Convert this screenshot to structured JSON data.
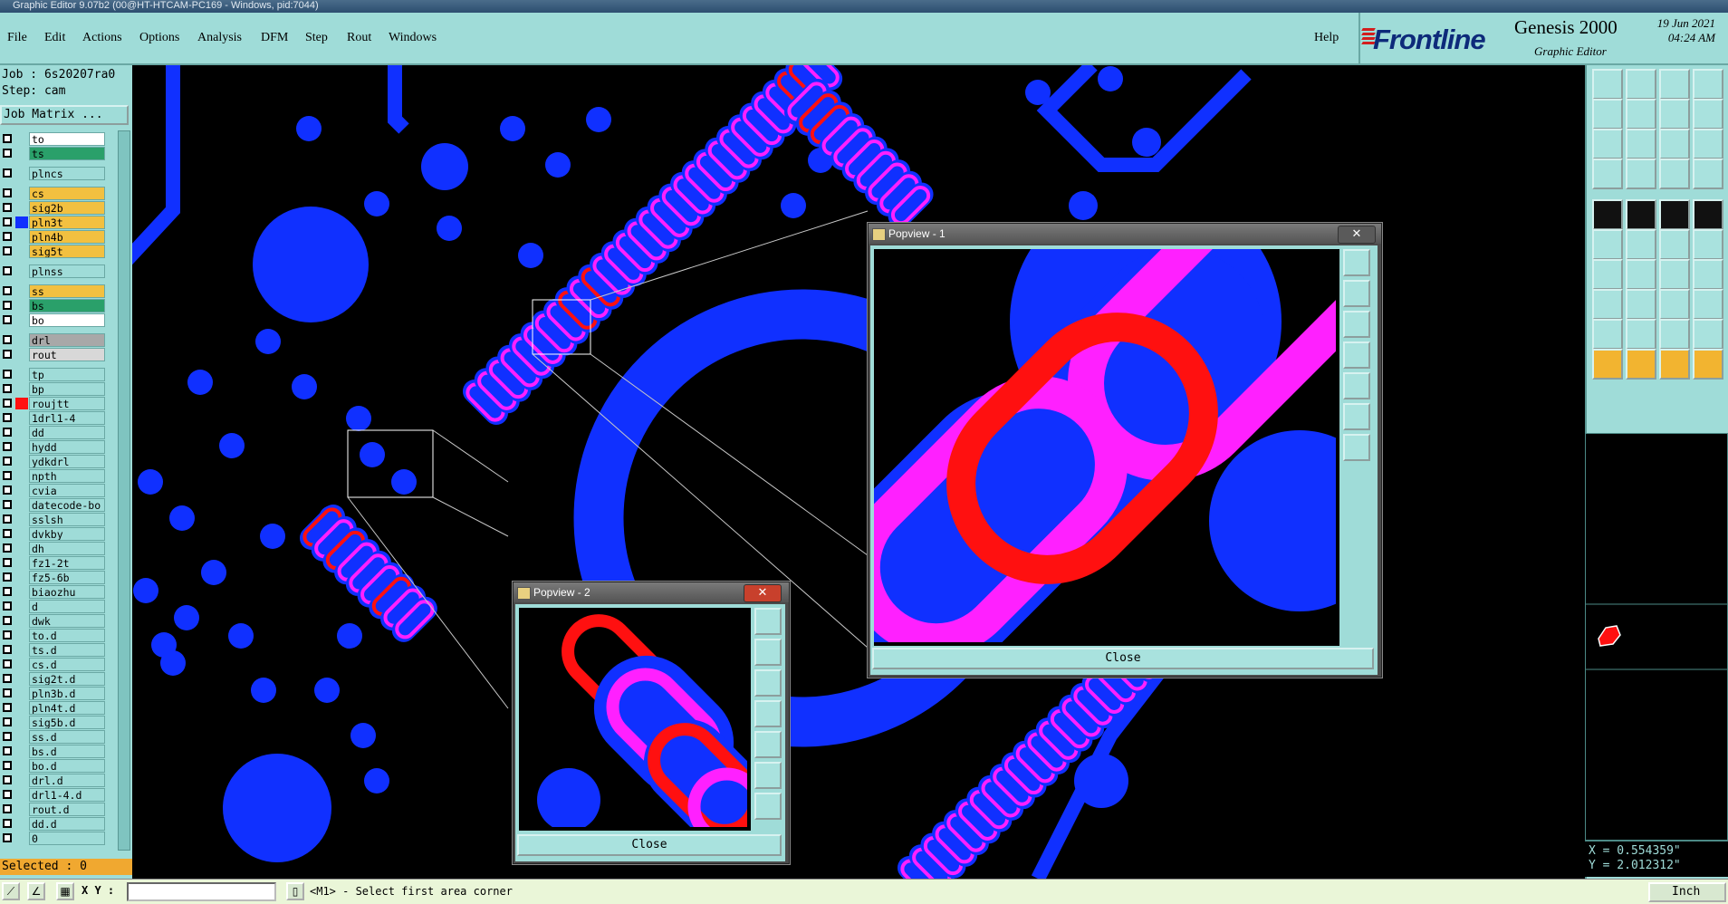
{
  "window": {
    "title": "Graphic Editor 9.07b2 (00@HT-HTCAM-PC169 - Windows, pid:7044)"
  },
  "menu": {
    "items": [
      "File",
      "Edit",
      "Actions",
      "Options",
      "Analysis",
      "DFM",
      "Step",
      "Rout",
      "Windows"
    ],
    "help": "Help"
  },
  "brand": {
    "logo": "Frontline",
    "product": "Genesis 2000",
    "subtitle": "Graphic Editor",
    "date": "19 Jun 2021",
    "time": "04:24 AM"
  },
  "job": {
    "job_line": "Job : 6s20207ra0",
    "step_line": "Step: cam",
    "matrix_button": "Job Matrix ..."
  },
  "layers": [
    {
      "name": "to",
      "color": "#ffffff"
    },
    {
      "name": "ts",
      "color": "#2aa06a"
    },
    {
      "name": "plncs",
      "color": "#9fdcd8"
    },
    {
      "name": "cs",
      "color": "#f2c040"
    },
    {
      "name": "sig2b",
      "color": "#f2c040"
    },
    {
      "name": "pln3t",
      "color": "#f2c040",
      "swatch": "#1030ff"
    },
    {
      "name": "pln4b",
      "color": "#f2c040"
    },
    {
      "name": "sig5t",
      "color": "#f2c040"
    },
    {
      "name": "plnss",
      "color": "#9fdcd8"
    },
    {
      "name": "ss",
      "color": "#f2c040"
    },
    {
      "name": "bs",
      "color": "#2aa06a"
    },
    {
      "name": "bo",
      "color": "#ffffff"
    },
    {
      "name": "drl",
      "color": "#a8a8a8"
    },
    {
      "name": "rout",
      "color": "#d8d8d8"
    },
    {
      "name": "tp",
      "color": "#9fdcd8"
    },
    {
      "name": "bp",
      "color": "#9fdcd8"
    },
    {
      "name": "roujtt",
      "color": "#9fdcd8",
      "swatch": "#ff1010"
    },
    {
      "name": "1drl1-4",
      "color": "#9fdcd8"
    },
    {
      "name": "dd",
      "color": "#9fdcd8"
    },
    {
      "name": "hydd",
      "color": "#9fdcd8"
    },
    {
      "name": "ydkdrl",
      "color": "#9fdcd8"
    },
    {
      "name": "npth",
      "color": "#9fdcd8"
    },
    {
      "name": "cvia",
      "color": "#9fdcd8"
    },
    {
      "name": "datecode-bo",
      "color": "#9fdcd8"
    },
    {
      "name": "sslsh",
      "color": "#9fdcd8"
    },
    {
      "name": "dvkby",
      "color": "#9fdcd8"
    },
    {
      "name": "dh",
      "color": "#9fdcd8"
    },
    {
      "name": "fz1-2t",
      "color": "#9fdcd8"
    },
    {
      "name": "fz5-6b",
      "color": "#9fdcd8"
    },
    {
      "name": "biaozhu",
      "color": "#9fdcd8"
    },
    {
      "name": "d",
      "color": "#9fdcd8"
    },
    {
      "name": "dwk",
      "color": "#9fdcd8"
    },
    {
      "name": "to.d",
      "color": "#9fdcd8"
    },
    {
      "name": "ts.d",
      "color": "#9fdcd8"
    },
    {
      "name": "cs.d",
      "color": "#9fdcd8"
    },
    {
      "name": "sig2t.d",
      "color": "#9fdcd8"
    },
    {
      "name": "pln3b.d",
      "color": "#9fdcd8"
    },
    {
      "name": "pln4t.d",
      "color": "#9fdcd8"
    },
    {
      "name": "sig5b.d",
      "color": "#9fdcd8"
    },
    {
      "name": "ss.d",
      "color": "#9fdcd8"
    },
    {
      "name": "bs.d",
      "color": "#9fdcd8"
    },
    {
      "name": "bo.d",
      "color": "#9fdcd8"
    },
    {
      "name": "drl.d",
      "color": "#9fdcd8"
    },
    {
      "name": "drl1-4.d",
      "color": "#9fdcd8"
    },
    {
      "name": "rout.d",
      "color": "#9fdcd8"
    },
    {
      "name": "dd.d",
      "color": "#9fdcd8"
    },
    {
      "name": "0",
      "color": "#9fdcd8"
    }
  ],
  "selected": "Selected : 0",
  "popview1": {
    "title": "Popview - 1",
    "close_label": "Close"
  },
  "popview2": {
    "title": "Popview - 2",
    "close_label": "Close"
  },
  "coords": {
    "x": "X = 0.554359\"",
    "y": "Y = 2.012312\""
  },
  "status": {
    "xy_label": "X Y :",
    "prompt": "<M1> - Select first area corner",
    "units": "Inch"
  },
  "colors": {
    "panel": "#9fdcd8",
    "layer_blue": "#1030ff",
    "layer_magenta": "#ff20ff",
    "layer_red": "#ff1010"
  }
}
